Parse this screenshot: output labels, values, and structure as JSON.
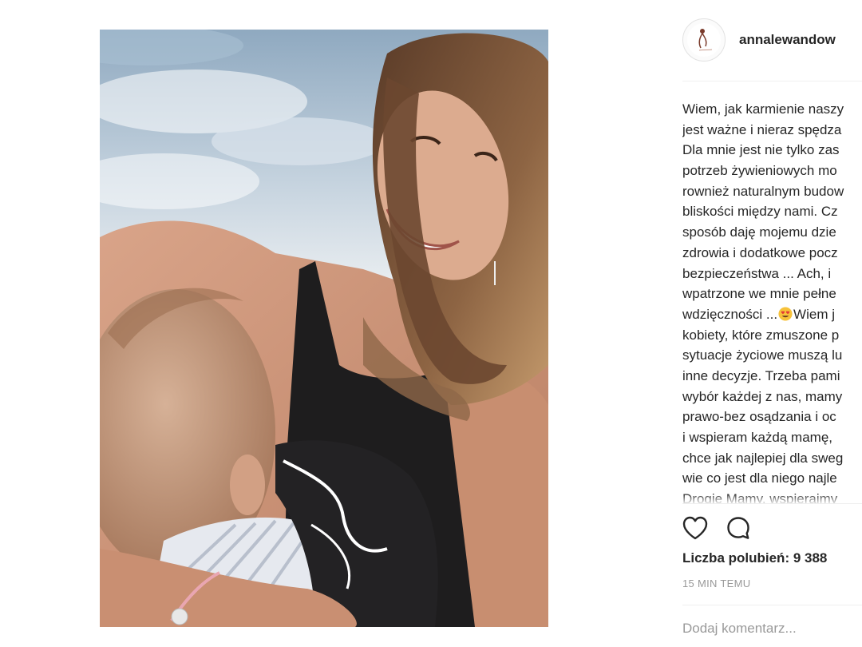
{
  "post": {
    "username": "annalewandow",
    "caption_lines": [
      "Wiem, jak karmienie naszy",
      "jest ważne i nieraz spędza",
      "Dla mnie jest nie tylko zas",
      "potrzeb żywieniowych mo",
      "rownież naturalnym budow",
      "bliskości między nami. Cz",
      "sposób daję mojemu dzie",
      "zdrowia i dodatkowe pocz",
      "bezpieczeństwa ... Ach, i",
      "wpatrzone we mnie pełne",
      "wdzięczności ...",
      "kobiety, które zmuszone p",
      "sytuacje życiowe muszą lu",
      "inne decyzje. Trzeba pami",
      "wybór każdej z nas, mamy",
      "prawo-bez osądzania i oc",
      "i wspieram każdą mamę,",
      "chce jak najlepiej dla sweg",
      "wie co jest dla niego najle",
      "Drogie Mamy, wspierajmy"
    ],
    "caption_line_11_after_emoji": "Wiem j",
    "emoji_name": "smiling-face-with-heart-eyes",
    "likes_text": "Liczba polubień: 9 388",
    "time_text": "15 MIN TEMU",
    "comment_placeholder": "Dodaj komentarz...",
    "icons": {
      "like": "heart-outline-icon",
      "comment": "speech-bubble-icon"
    }
  },
  "colors": {
    "text": "#262626",
    "muted": "#999999",
    "divider": "#efefef"
  }
}
